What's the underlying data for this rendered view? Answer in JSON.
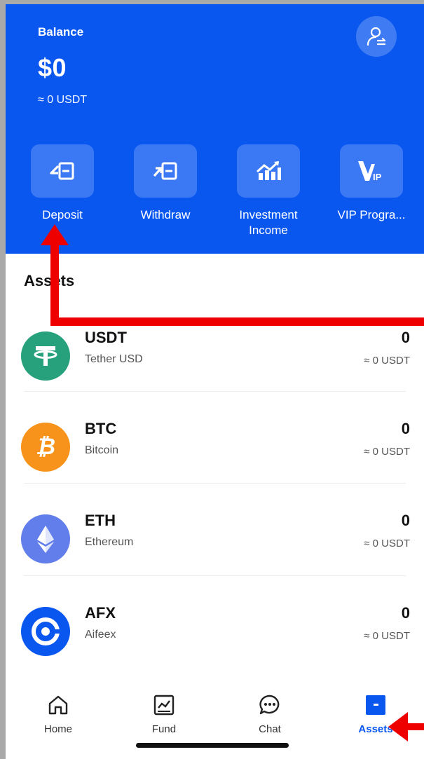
{
  "header": {
    "balance_label": "Balance",
    "balance_amount": "$0",
    "balance_usdt": "≈ 0 USDT",
    "profile_icon": "profile-switch-icon",
    "bg_color": "#0a57f0"
  },
  "actions": [
    {
      "label": "Deposit",
      "icon": "deposit-icon"
    },
    {
      "label": "Withdraw",
      "icon": "withdraw-icon"
    },
    {
      "label": "Investment Income",
      "icon": "chart-growth-icon"
    },
    {
      "label": "VIP Progra...",
      "icon": "vip-icon"
    }
  ],
  "assets": {
    "title": "Assets",
    "items": [
      {
        "symbol": "USDT",
        "name": "Tether USD",
        "amount": "0",
        "approx": "≈ 0 USDT",
        "color": "#26a17b"
      },
      {
        "symbol": "BTC",
        "name": "Bitcoin",
        "amount": "0",
        "approx": "≈ 0 USDT",
        "color": "#f7931a"
      },
      {
        "symbol": "ETH",
        "name": "Ethereum",
        "amount": "0",
        "approx": "≈ 0 USDT",
        "color": "#627eea"
      },
      {
        "symbol": "AFX",
        "name": "Aifeex",
        "amount": "0",
        "approx": "≈ 0 USDT",
        "color": "#0a57f0"
      }
    ]
  },
  "nav": {
    "items": [
      {
        "label": "Home",
        "icon": "home-icon",
        "active": false
      },
      {
        "label": "Fund",
        "icon": "fund-chart-icon",
        "active": false
      },
      {
        "label": "Chat",
        "icon": "chat-icon",
        "active": false
      },
      {
        "label": "Assets",
        "icon": "assets-icon",
        "active": true
      }
    ],
    "active_color": "#0a57f0"
  },
  "annotation_color": "#ee0000"
}
